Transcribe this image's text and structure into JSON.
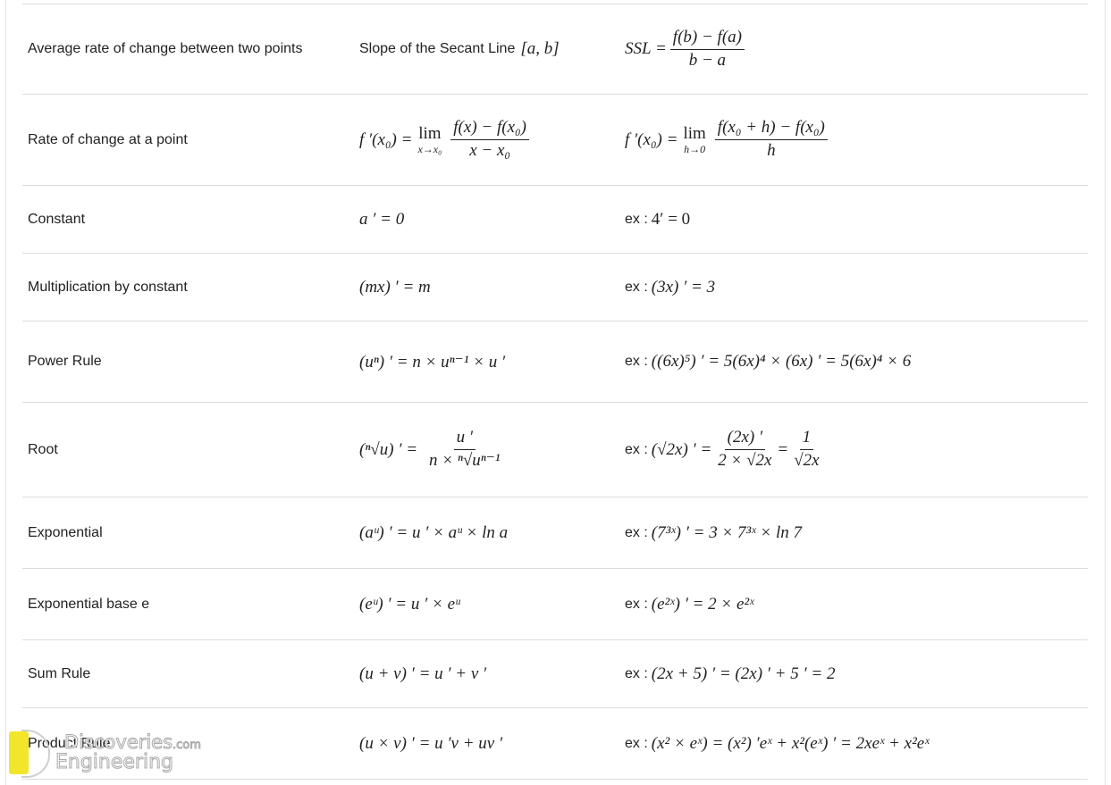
{
  "table": {
    "rows": [
      {
        "name": "Average rate of change between two points",
        "formula_text": "Slope of the Secant Line",
        "formula_interval": "[a, b]",
        "example_lhs": "SSL =",
        "example_num": "f(b) − f(a)",
        "example_den": "b − a"
      },
      {
        "name": "Rate of change at a point",
        "formula_lhs": "f ′(x₀) =",
        "formula_lim": "lim",
        "formula_lim_sub": "x→x₀",
        "formula_num": "f(x) − f(x₀)",
        "formula_den": "x − x₀",
        "example_lhs": "f ′(x₀) =",
        "example_lim": "lim",
        "example_lim_sub": "h→0",
        "example_num": "f(x₀ + h) − f(x₀)",
        "example_den": "h"
      },
      {
        "name": "Constant",
        "formula": "a ′ = 0",
        "example_prefix": "ex :",
        "example": "4′ = 0"
      },
      {
        "name": "Multiplication by constant",
        "formula": "(mx) ′ = m",
        "example_prefix": "ex :",
        "example": "(3x) ′ = 3"
      },
      {
        "name": "Power Rule",
        "formula": "(uⁿ) ′ = n × uⁿ⁻¹ × u ′",
        "example_prefix": "ex :",
        "example": "((6x)⁵) ′ = 5(6x)⁴ × (6x) ′ = 5(6x)⁴ × 6"
      },
      {
        "name": "Root",
        "formula_lhs": "(ⁿ√u) ′ =",
        "formula_num": "u ′",
        "formula_den": "n × ⁿ√uⁿ⁻¹",
        "example_prefix": "ex :",
        "example_lhs": "(√2x) ′ =",
        "example_num": "(2x) ′",
        "example_den": "2 × √2x",
        "example_eq": "=",
        "example_num2": "1",
        "example_den2": "√2x"
      },
      {
        "name": "Exponential",
        "formula": "(aᵘ) ′ = u ′ × aᵘ × ln a",
        "example_prefix": "ex :",
        "example": "(7³ˣ) ′ = 3 × 7³ˣ × ln 7"
      },
      {
        "name": "Exponential base e",
        "formula": "(eᵘ) ′ = u ′ × eᵘ",
        "example_prefix": "ex :",
        "example": "(e²ˣ) ′ = 2 × e²ˣ"
      },
      {
        "name": "Sum Rule",
        "formula": "(u + v) ′ = u ′ + v ′",
        "example_prefix": "ex :",
        "example": "(2x + 5) ′ = (2x) ′ + 5 ′ = 2"
      },
      {
        "name": "Product Rule",
        "formula": "(u × v) ′ = u ′v + uv ′",
        "example_prefix": "ex :",
        "example": "(x² × eˣ) = (x²) ′eˣ + x²(eˣ) ′ = 2xeˣ + x²eˣ"
      }
    ]
  },
  "watermark": {
    "line1": "Discoveries",
    "line1_suffix": ".com",
    "line2": "Engineering",
    "brand_color": "#f2e62b"
  }
}
